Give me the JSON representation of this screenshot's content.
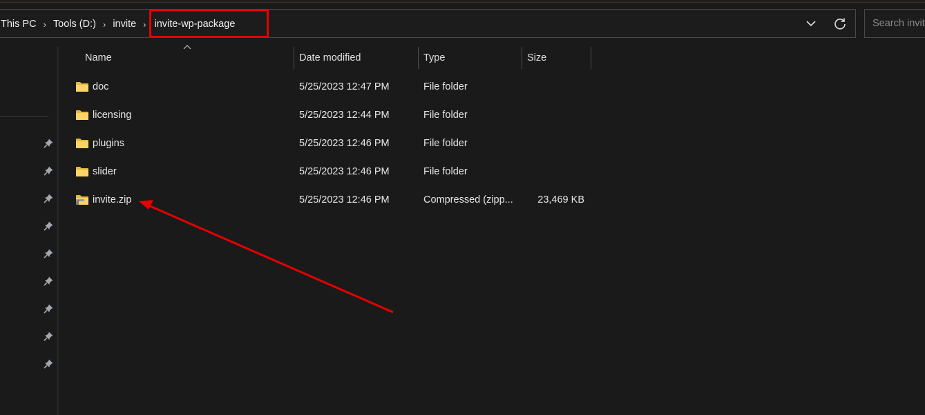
{
  "address_bar": {
    "breadcrumbs": [
      "This PC",
      "Tools (D:)",
      "invite",
      "invite-wp-package"
    ],
    "highlight_color": "#e80000"
  },
  "search": {
    "placeholder": "Search invite-wp-package",
    "value": ""
  },
  "columns": {
    "name": "Name",
    "date": "Date modified",
    "type": "Type",
    "size": "Size",
    "sorted_by": "Name",
    "sort_direction": "ascending"
  },
  "files": [
    {
      "name": "doc",
      "icon": "folder-icon",
      "date": "5/25/2023 12:47 PM",
      "type": "File folder",
      "size": ""
    },
    {
      "name": "licensing",
      "icon": "folder-icon",
      "date": "5/25/2023 12:44 PM",
      "type": "File folder",
      "size": ""
    },
    {
      "name": "plugins",
      "icon": "folder-icon",
      "date": "5/25/2023 12:46 PM",
      "type": "File folder",
      "size": ""
    },
    {
      "name": "slider",
      "icon": "folder-icon",
      "date": "5/25/2023 12:46 PM",
      "type": "File folder",
      "size": ""
    },
    {
      "name": "invite.zip",
      "icon": "zip-folder-icon",
      "date": "5/25/2023 12:46 PM",
      "type": "Compressed (zipp...",
      "size": "23,469 KB"
    }
  ],
  "quick_access_pins": 9,
  "annotation": {
    "type": "arrow",
    "points_to": "invite.zip",
    "color": "#e80000"
  }
}
